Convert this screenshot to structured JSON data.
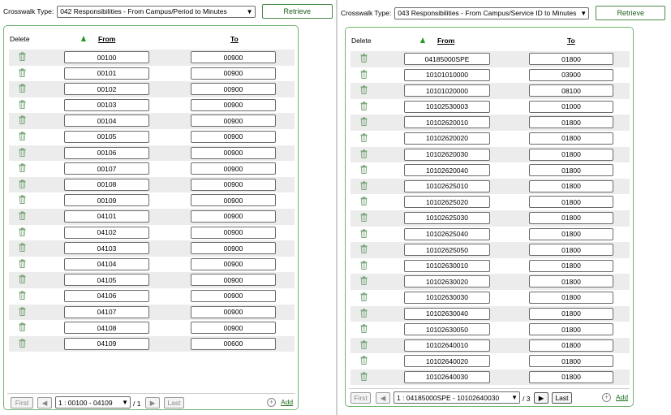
{
  "left": {
    "crosswalk_label": "Crosswalk Type:",
    "crosswalk_value": "042 Responsibilities - From Campus/Period to Minutes",
    "retrieve_label": "Retrieve",
    "headers": {
      "delete": "Delete",
      "from": "From",
      "to": "To"
    },
    "rows": [
      {
        "from": "00100",
        "to": "00900"
      },
      {
        "from": "00101",
        "to": "00900"
      },
      {
        "from": "00102",
        "to": "00900"
      },
      {
        "from": "00103",
        "to": "00900"
      },
      {
        "from": "00104",
        "to": "00900"
      },
      {
        "from": "00105",
        "to": "00900"
      },
      {
        "from": "00106",
        "to": "00900"
      },
      {
        "from": "00107",
        "to": "00900"
      },
      {
        "from": "00108",
        "to": "00900"
      },
      {
        "from": "00109",
        "to": "00900"
      },
      {
        "from": "04101",
        "to": "00900"
      },
      {
        "from": "04102",
        "to": "00900"
      },
      {
        "from": "04103",
        "to": "00900"
      },
      {
        "from": "04104",
        "to": "00900"
      },
      {
        "from": "04105",
        "to": "00900"
      },
      {
        "from": "04106",
        "to": "00900"
      },
      {
        "from": "04107",
        "to": "00900"
      },
      {
        "from": "04108",
        "to": "00900"
      },
      {
        "from": "04109",
        "to": "00600"
      }
    ],
    "pager": {
      "first": "First",
      "last": "Last",
      "page_select": "1 : 00100 - 04109",
      "total": "/ 1",
      "add": "Add"
    }
  },
  "right": {
    "crosswalk_label": "Crosswalk Type:",
    "crosswalk_value": "043 Responsibilities - From Campus/Service ID to Minutes",
    "retrieve_label": "Retrieve",
    "headers": {
      "delete": "Delete",
      "from": "From",
      "to": "To"
    },
    "rows": [
      {
        "from": "04185000SPE",
        "to": "01800"
      },
      {
        "from": "10101010000",
        "to": "03900"
      },
      {
        "from": "10101020000",
        "to": "08100"
      },
      {
        "from": "10102530003",
        "to": "01000"
      },
      {
        "from": "10102620010",
        "to": "01800"
      },
      {
        "from": "10102620020",
        "to": "01800"
      },
      {
        "from": "10102620030",
        "to": "01800"
      },
      {
        "from": "10102620040",
        "to": "01800"
      },
      {
        "from": "10102625010",
        "to": "01800"
      },
      {
        "from": "10102625020",
        "to": "01800"
      },
      {
        "from": "10102625030",
        "to": "01800"
      },
      {
        "from": "10102625040",
        "to": "01800"
      },
      {
        "from": "10102625050",
        "to": "01800"
      },
      {
        "from": "10102630010",
        "to": "01800"
      },
      {
        "from": "10102630020",
        "to": "01800"
      },
      {
        "from": "10102630030",
        "to": "01800"
      },
      {
        "from": "10102630040",
        "to": "01800"
      },
      {
        "from": "10102630050",
        "to": "01800"
      },
      {
        "from": "10102640010",
        "to": "01800"
      },
      {
        "from": "10102640020",
        "to": "01800"
      },
      {
        "from": "10102640030",
        "to": "01800"
      }
    ],
    "pager": {
      "first": "First",
      "last": "Last",
      "page_select": "1 : 04185000SPE - 10102640030",
      "total": "/ 3",
      "add": "Add"
    }
  },
  "colors": {
    "accent": "#1e9a1e",
    "card_border": "#6fb56f",
    "row_alt": "#ececec"
  },
  "icons": {
    "delete": "trash-icon",
    "sort": "sort-ascending-icon",
    "add": "add-circle-icon",
    "prev": "chevron-left-icon",
    "next": "chevron-right-icon",
    "dropdown": "chevron-down-icon"
  }
}
